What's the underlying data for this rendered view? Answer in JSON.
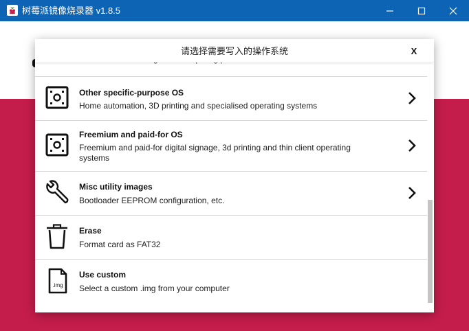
{
  "window": {
    "title": "树莓派镜像烧录器 v1.8.5",
    "icons": [
      "raspberry-icon",
      "minimize-icon",
      "maximize-icon",
      "close-icon"
    ]
  },
  "dialog": {
    "title": "请选择需要写入的操作系统",
    "close_label": "X",
    "items": [
      {
        "title": "",
        "description": "Emulators for running retro-computing platforms",
        "icon": "gamepad-icon",
        "has_submenu": true
      },
      {
        "title": "Other specific-purpose OS",
        "description": "Home automation, 3D printing and specialised operating systems",
        "icon": "board-icon",
        "has_submenu": true
      },
      {
        "title": "Freemium and paid-for OS",
        "description": "Freemium and paid-for digital signage, 3d printing and thin client operating systems",
        "icon": "board-icon",
        "has_submenu": true
      },
      {
        "title": "Misc utility images",
        "description": "Bootloader EEPROM configuration, etc.",
        "icon": "wrench-icon",
        "has_submenu": true
      },
      {
        "title": "Erase",
        "description": "Format card as FAT32",
        "icon": "trash-icon",
        "has_submenu": false
      },
      {
        "title": "Use custom",
        "description": "Select a custom .img from your computer",
        "icon": "img-file-icon",
        "icon_label": ".img",
        "has_submenu": false
      }
    ]
  },
  "colors": {
    "titlebar": "#0d63b4",
    "background_accent": "#c51d4b",
    "scrollbar_thumb": "#c4c4c4"
  }
}
